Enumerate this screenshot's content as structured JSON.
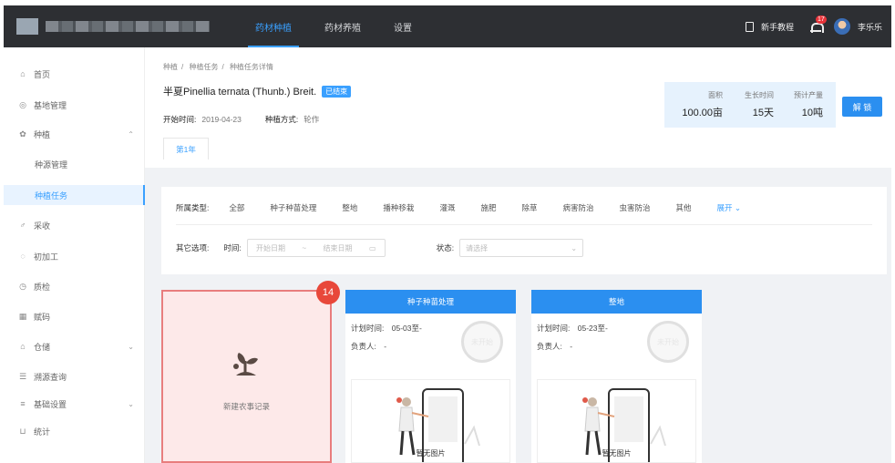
{
  "topbar": {
    "nav": [
      {
        "label": "药材种植",
        "active": true
      },
      {
        "label": "药材养殖",
        "active": false
      },
      {
        "label": "设置",
        "active": false
      }
    ],
    "tutorial_label": "新手教程",
    "notification_count": "17",
    "user_name": "李乐乐",
    "accent_color": "#3aa0ff"
  },
  "sidebar": {
    "items": [
      {
        "label": "首页",
        "icon": "home-icon"
      },
      {
        "label": "基地管理",
        "icon": "location-icon"
      },
      {
        "label": "种植",
        "icon": "planting-icon",
        "expanded": true
      },
      {
        "label": "种源管理",
        "sub": true
      },
      {
        "label": "种植任务",
        "sub": true,
        "active": true
      },
      {
        "label": "采收",
        "icon": "harvest-icon"
      },
      {
        "label": "初加工",
        "icon": "processing-icon"
      },
      {
        "label": "质检",
        "icon": "inspection-icon"
      },
      {
        "label": "赋码",
        "icon": "qrcode-icon"
      },
      {
        "label": "仓储",
        "icon": "warehouse-icon",
        "collapsible": true
      },
      {
        "label": "溯源查询",
        "icon": "trace-icon"
      },
      {
        "label": "基础设置",
        "icon": "settings-icon",
        "collapsible": true
      },
      {
        "label": "统计",
        "icon": "stats-icon"
      }
    ]
  },
  "header": {
    "breadcrumb": [
      "种植",
      "种植任务",
      "种植任务详情"
    ],
    "title": "半夏Pinellia ternata (Thunb.) Breit.",
    "status": "已结束",
    "start_label": "开始时间:",
    "start_value": "2019-04-23",
    "method_label": "种植方式:",
    "method_value": "轮作",
    "year_tab": "第1年",
    "stats": {
      "area_label": "面积",
      "area_value": "100.00亩",
      "period_label": "生长时间",
      "period_value": "15天",
      "yield_label": "预计产量",
      "yield_value": "10吨"
    },
    "unlock_label": "解 锁"
  },
  "filters": {
    "type_label": "所属类型:",
    "types": [
      "全部",
      "种子种苗处理",
      "整地",
      "播种移栽",
      "灌溉",
      "施肥",
      "除草",
      "病害防治",
      "虫害防治",
      "其他"
    ],
    "expand_label": "展开",
    "other_label": "其它选项:",
    "time_label": "时间:",
    "start_placeholder": "开始日期",
    "end_placeholder": "结束日期",
    "state_label": "状态:",
    "state_placeholder": "请选择"
  },
  "new_record": {
    "badge": "14",
    "label": "新建农事记录",
    "highlight_color": "#e8483a"
  },
  "tasks": [
    {
      "title": "种子种苗处理",
      "plan_label": "计划时间:",
      "plan_value": "05-03至-",
      "owner_label": "负责人:",
      "owner_value": "-",
      "stamp": "未开始",
      "no_image": "暂无图片"
    },
    {
      "title": "整地",
      "plan_label": "计划时间:",
      "plan_value": "05-23至-",
      "owner_label": "负责人:",
      "owner_value": "-",
      "stamp": "未开始",
      "no_image": "暂无图片"
    }
  ]
}
